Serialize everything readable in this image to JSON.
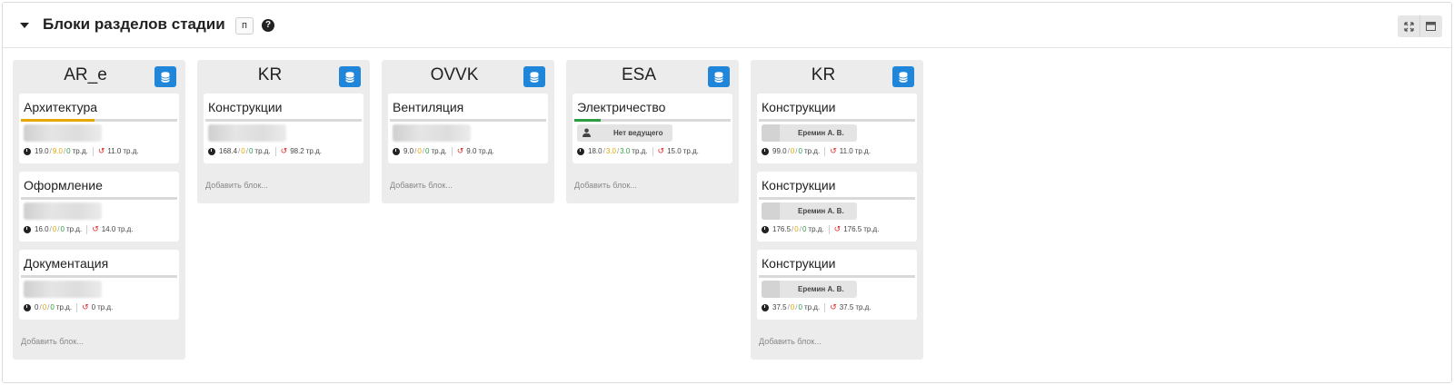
{
  "header": {
    "title": "Блоки разделов стадии",
    "mode_badge": "п",
    "help_glyph": "?"
  },
  "add_block_label": "Добавить блок...",
  "unit": "тр.д.",
  "colors": {
    "accent_blue": "#1f86d9",
    "progress_yellow": "#e6a700",
    "progress_green": "#2e9e45",
    "history_red": "#e02626"
  },
  "columns": [
    {
      "name": "AR_e",
      "cards": [
        {
          "title": "Архитектура",
          "progress": 0.47,
          "progress_color": "#e6a700",
          "assignee": "",
          "stats": {
            "total": "19.0",
            "a": "9.0",
            "b": "0",
            "c": "11.0"
          }
        },
        {
          "title": "Оформление",
          "progress": 0,
          "progress_color": "#2e9e45",
          "assignee": "",
          "stats": {
            "total": "16.0",
            "a": "0",
            "b": "0",
            "c": "14.0"
          }
        },
        {
          "title": "Документация",
          "progress": 0,
          "progress_color": "#2e9e45",
          "assignee": "",
          "stats": {
            "total": "0",
            "a": "0",
            "b": "0",
            "c": "0"
          }
        }
      ]
    },
    {
      "name": "KR",
      "cards": [
        {
          "title": "Конструкции",
          "progress": 0,
          "progress_color": "#2e9e45",
          "assignee": "",
          "stats": {
            "total": "168.4",
            "a": "0",
            "b": "0",
            "c": "98.2"
          }
        }
      ]
    },
    {
      "name": "OVVK",
      "cards": [
        {
          "title": "Вентиляция",
          "progress": 0,
          "progress_color": "#2e9e45",
          "assignee": "",
          "stats": {
            "total": "9.0",
            "a": "0",
            "b": "0",
            "c": "9.0"
          }
        }
      ]
    },
    {
      "name": "ESA",
      "cards": [
        {
          "title": "Электричество",
          "progress": 0.17,
          "progress_color": "#2e9e45",
          "assignee": "Нет ведущего",
          "stats": {
            "total": "18.0",
            "a": "3.0",
            "b": "3.0",
            "c": "15.0"
          }
        }
      ]
    },
    {
      "name": "KR",
      "cards": [
        {
          "title": "Конструкции",
          "progress": 0,
          "progress_color": "#2e9e45",
          "assignee": "Еремин А. В.",
          "stats": {
            "total": "99.0",
            "a": "0",
            "b": "0",
            "c": "11.0"
          }
        },
        {
          "title": "Конструкции",
          "progress": 0,
          "progress_color": "#2e9e45",
          "assignee": "Еремин А. В.",
          "stats": {
            "total": "176.5",
            "a": "0",
            "b": "0",
            "c": "176.5"
          }
        },
        {
          "title": "Конструкции",
          "progress": 0,
          "progress_color": "#2e9e45",
          "assignee": "Еремин А. В.",
          "stats": {
            "total": "37.5",
            "a": "0",
            "b": "0",
            "c": "37.5"
          }
        }
      ]
    }
  ]
}
